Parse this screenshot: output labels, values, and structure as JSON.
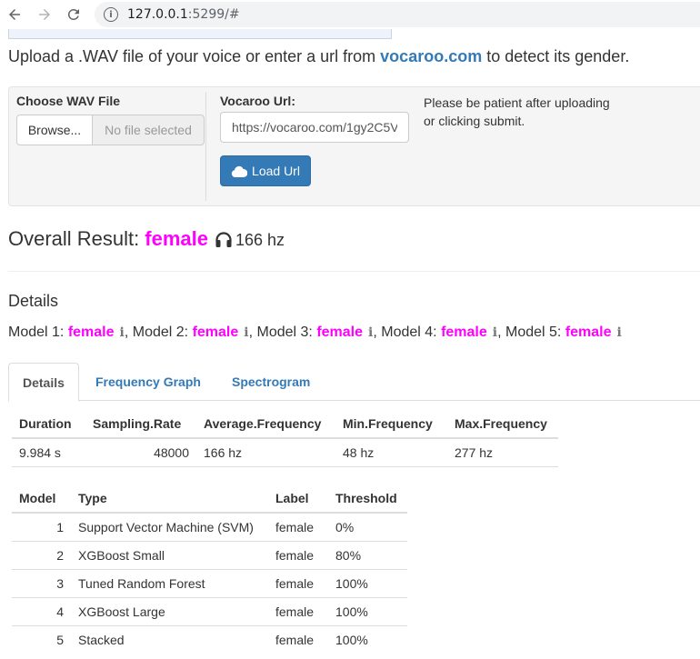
{
  "browser": {
    "url_host": "127.0.0.1",
    "url_rest": ":5299/#"
  },
  "intro": {
    "prefix": "Upload a .WAV file of your voice or enter a url from ",
    "link": "vocaroo.com",
    "suffix": " to detect its gender."
  },
  "upload": {
    "file_label": "Choose WAV File",
    "browse_label": "Browse...",
    "no_file": "No file selected",
    "url_label": "Vocaroo Url:",
    "url_value": "https://vocaroo.com/1gy2C5V",
    "load_label": "Load Url",
    "patience_note": "Please be patient after uploading or clicking submit."
  },
  "result": {
    "label": "Overall Result:",
    "gender": "female",
    "frequency": "166 hz"
  },
  "details": {
    "title": "Details",
    "models": [
      {
        "label": "Model 1:",
        "gender": "female"
      },
      {
        "label": ", Model 2:",
        "gender": "female"
      },
      {
        "label": ", Model 3:",
        "gender": "female"
      },
      {
        "label": ", Model 4:",
        "gender": "female"
      },
      {
        "label": ", Model 5:",
        "gender": "female"
      }
    ],
    "info_glyph": "i"
  },
  "tabs": [
    "Details",
    "Frequency Graph",
    "Spectrogram"
  ],
  "summary_table": {
    "headers": [
      "Duration",
      "Sampling.Rate",
      "Average.Frequency",
      "Min.Frequency",
      "Max.Frequency"
    ],
    "row": [
      "9.984 s",
      "48000",
      "166 hz",
      "48 hz",
      "277 hz"
    ]
  },
  "model_table": {
    "headers": [
      "Model",
      "Type",
      "Label",
      "Threshold"
    ],
    "rows": [
      [
        "1",
        "Support Vector Machine (SVM)",
        "female",
        "0%"
      ],
      [
        "2",
        "XGBoost Small",
        "female",
        "80%"
      ],
      [
        "3",
        "Tuned Random Forest",
        "female",
        "100%"
      ],
      [
        "4",
        "XGBoost Large",
        "female",
        "100%"
      ],
      [
        "5",
        "Stacked",
        "female",
        "100%"
      ]
    ]
  },
  "colors": {
    "accent": "#337ab7",
    "female": "#ff00ff"
  },
  "icons": [
    "back-arrow-icon",
    "forward-arrow-icon",
    "reload-icon",
    "info-icon",
    "cloud-icon",
    "headphones-icon"
  ]
}
